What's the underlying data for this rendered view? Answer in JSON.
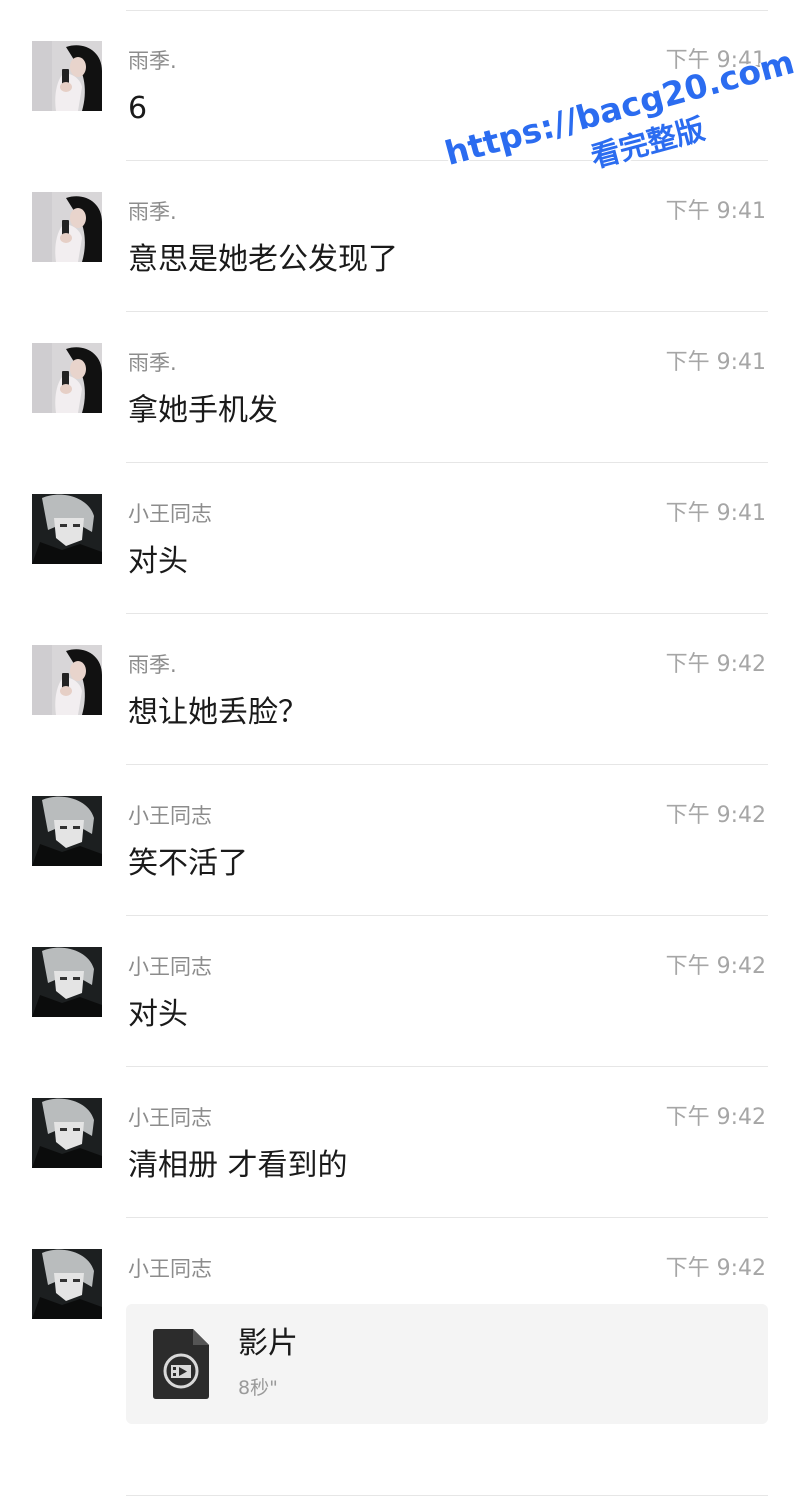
{
  "messages": [
    {
      "sender": "雨季.",
      "time": "下午 9:41",
      "text": "6",
      "avatar": "girl-avatar"
    },
    {
      "sender": "雨季.",
      "time": "下午 9:41",
      "text": "意思是她老公发现了",
      "avatar": "girl-avatar"
    },
    {
      "sender": "雨季.",
      "time": "下午 9:41",
      "text": "拿她手机发",
      "avatar": "girl-avatar"
    },
    {
      "sender": "小王同志",
      "time": "下午 9:41",
      "text": "对头",
      "avatar": "anime-boy-avatar"
    },
    {
      "sender": "雨季.",
      "time": "下午 9:42",
      "text": "想让她丢脸？",
      "avatar": "girl-avatar"
    },
    {
      "sender": "小王同志",
      "time": "下午 9:42",
      "text": "笑不活了",
      "avatar": "anime-boy-avatar"
    },
    {
      "sender": "小王同志",
      "time": "下午 9:42",
      "text": "对头",
      "avatar": "anime-boy-avatar"
    },
    {
      "sender": "小王同志",
      "time": "下午 9:42",
      "text": "清相册 才看到的",
      "avatar": "anime-boy-avatar"
    },
    {
      "sender": "小王同志",
      "time": "下午 9:42",
      "avatar": "anime-boy-avatar",
      "video": {
        "title": "影片",
        "duration": "8秒\"",
        "icon": "video-file-icon"
      }
    }
  ],
  "watermark": {
    "url": "https://bacg20.com",
    "subtitle": "看完整版"
  },
  "colors": {
    "divider": "#e6e6e6",
    "sender": "#8c8c8c",
    "time": "#a6a6a6",
    "text": "#1a1a1a",
    "card": "#f4f4f4",
    "watermark": "#2b6cf0"
  }
}
